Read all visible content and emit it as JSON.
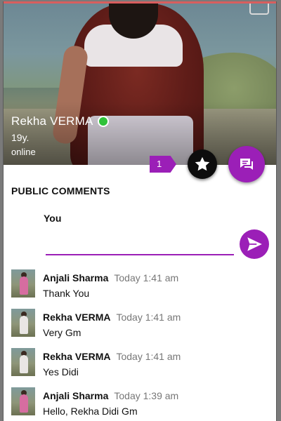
{
  "profile": {
    "name": "Rekha VERMA",
    "age": "19y.",
    "status": "online",
    "online_color": "#30c23a"
  },
  "actions": {
    "favorite_count": "1",
    "favorite_icon": "star-icon",
    "chat_icon": "chat-icon"
  },
  "comments_section": {
    "title": "PUBLIC COMMENTS",
    "composer_label": "You",
    "composer_value": "",
    "send_icon": "send-icon"
  },
  "comments": [
    {
      "author": "Anjali Sharma",
      "time": "Today 1:41 am",
      "text": "Thank You",
      "avatar": "pink"
    },
    {
      "author": "Rekha VERMA",
      "time": "Today 1:41 am",
      "text": "Very Gm",
      "avatar": "white"
    },
    {
      "author": "Rekha VERMA",
      "time": "Today 1:41 am",
      "text": "Yes Didi",
      "avatar": "white"
    },
    {
      "author": "Anjali Sharma",
      "time": "Today 1:39 am",
      "text": "Hello, Rekha Didi Gm",
      "avatar": "pink"
    }
  ],
  "colors": {
    "accent": "#9b1fb7",
    "top_bar": "#d95e5e"
  }
}
